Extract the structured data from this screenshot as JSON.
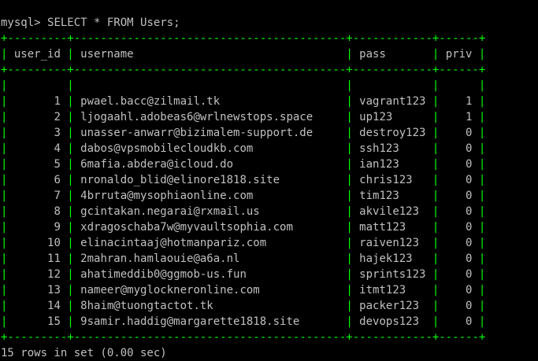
{
  "prompt": "mysql> ",
  "command": "SELECT * FROM Users;",
  "border": "+---------+-----------------------------------------+------------+------+",
  "columns": [
    "user_id",
    "username",
    "pass",
    "priv"
  ],
  "rows": [
    [
      "1",
      "pwael.bacc@zilmail.tk",
      "vagrant123",
      "1"
    ],
    [
      "2",
      "ljogaahl.adobeas6@wrlnewstops.space",
      "up123",
      "1"
    ],
    [
      "3",
      "unasser-anwarr@bizimalem-support.de",
      "destroy123",
      "0"
    ],
    [
      "4",
      "dabos@vpsmobilecloudkb.com",
      "ssh123",
      "0"
    ],
    [
      "5",
      "6mafia.abdera@icloud.do",
      "ian123",
      "0"
    ],
    [
      "6",
      "nronaldo_blid@elinore1818.site",
      "chris123",
      "0"
    ],
    [
      "7",
      "4brruta@mysophiaonline.com",
      "tim123",
      "0"
    ],
    [
      "8",
      "gcintakan.negarai@rxmail.us",
      "akvile123",
      "0"
    ],
    [
      "9",
      "xdragoschaba7w@myvaultsophia.com",
      "matt123",
      "0"
    ],
    [
      "10",
      "elinacintaaj@hotmanpariz.com",
      "raiven123",
      "0"
    ],
    [
      "11",
      "2mahran.hamlaouie@a6a.nl",
      "hajek123",
      "0"
    ],
    [
      "12",
      "ahatimeddib0@ggmob-us.fun",
      "sprints123",
      "0"
    ],
    [
      "13",
      "nameer@myglockneronline.com",
      "itmt123",
      "0"
    ],
    [
      "14",
      "8haim@tuongtactot.tk",
      "packer123",
      "0"
    ],
    [
      "15",
      "9samir.haddig@margarette1818.site",
      "devops123",
      "0"
    ]
  ],
  "footer": "15 rows in set (0.00 sec)",
  "colors": {
    "background": "#000000",
    "text": "#c0c0c0",
    "border": "#00ff00"
  }
}
